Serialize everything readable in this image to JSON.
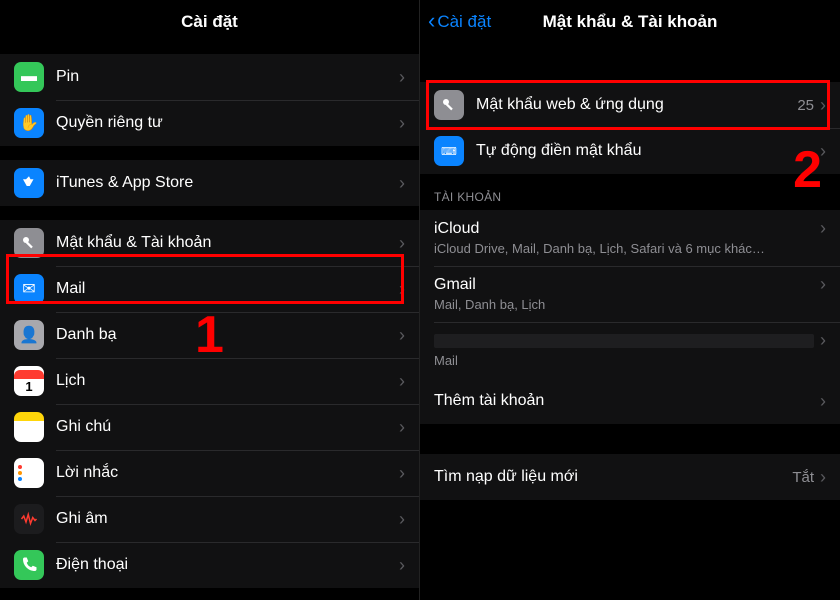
{
  "left": {
    "title": "Cài đặt",
    "groups": [
      [
        {
          "icon": "pin-icon",
          "bg": "bg-green",
          "label": "Pin"
        },
        {
          "icon": "hand-icon",
          "bg": "bg-blue",
          "label": "Quyền riêng tư"
        }
      ],
      [
        {
          "icon": "appstore-icon",
          "bg": "bg-appstore",
          "label": "iTunes & App Store"
        }
      ],
      [
        {
          "icon": "key-icon",
          "bg": "bg-gray",
          "label": "Mật khẩu & Tài khoản",
          "highlighted": true
        },
        {
          "icon": "mail-icon",
          "bg": "bg-blue",
          "label": "Mail"
        },
        {
          "icon": "contacts-icon",
          "bg": "bg-gray",
          "label": "Danh bạ"
        },
        {
          "icon": "calendar-icon",
          "bg": "bg-white",
          "label": "Lịch"
        },
        {
          "icon": "notes-icon",
          "bg": "bg-yellow",
          "label": "Ghi chú"
        },
        {
          "icon": "reminders-icon",
          "bg": "bg-orange",
          "label": "Lời nhắc"
        },
        {
          "icon": "voicememo-icon",
          "bg": "bg-teal",
          "label": "Ghi âm"
        },
        {
          "icon": "phone-icon",
          "bg": "bg-green",
          "label": "Điện thoại"
        }
      ]
    ],
    "step_number": "1"
  },
  "right": {
    "back_label": "Cài đặt",
    "title": "Mật khẩu & Tài khoản",
    "password_rows": [
      {
        "icon": "key-icon",
        "bg": "bg-gray",
        "label": "Mật khẩu web & ứng dụng",
        "detail": "25",
        "highlighted": true
      },
      {
        "icon": "keyboard-icon",
        "bg": "bg-blue",
        "label": "Tự động điền mật khẩu"
      }
    ],
    "accounts_header": "TÀI KHOẢN",
    "accounts": [
      {
        "name": "iCloud",
        "sub": "iCloud Drive, Mail, Danh bạ, Lịch, Safari và 6 mục khác…"
      },
      {
        "name": "Gmail",
        "sub": "Mail, Danh bạ, Lịch"
      },
      {
        "name": "",
        "sub": "Mail",
        "dim": true
      }
    ],
    "add_account": "Thêm tài khoản",
    "fetch_label": "Tìm nạp dữ liệu mới",
    "fetch_value": "Tắt",
    "step_number": "2"
  }
}
